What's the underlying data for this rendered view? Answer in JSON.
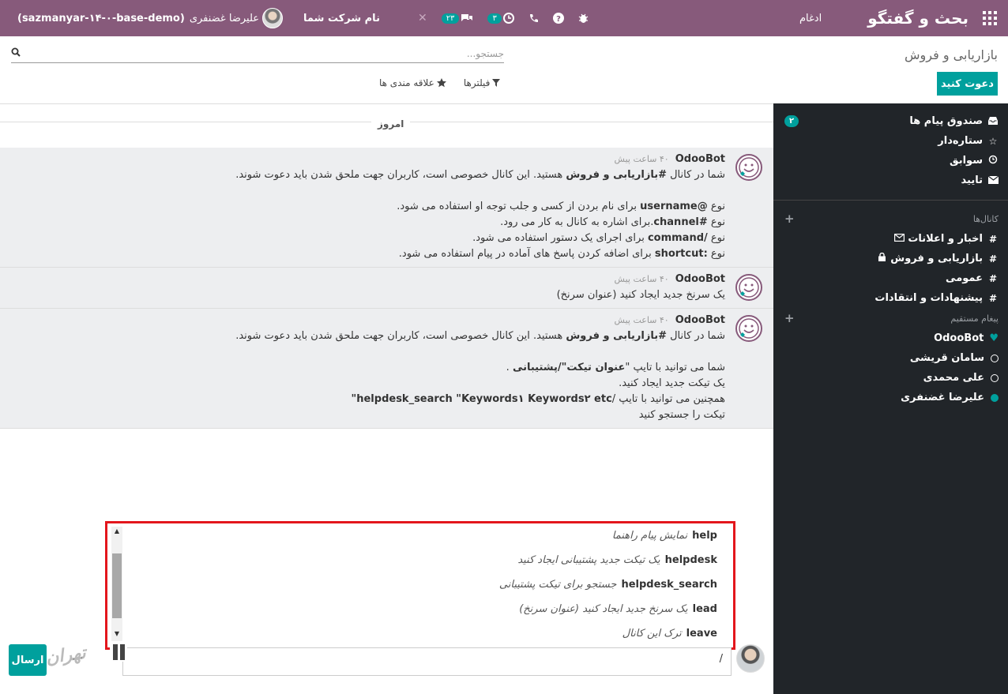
{
  "navbar": {
    "brand": "بحث و گفتگو",
    "merge": "ادغام",
    "company": "نام شرکت شما",
    "user_name": "علیرضا غضنفری",
    "db_name": "(sazmanyar-۱۴-۰-base-demo)",
    "messages_count": "۲۳",
    "activities_count": "۳"
  },
  "control": {
    "title": "بازاریابی و فروش",
    "invite_label": "دعوت کنید",
    "search_placeholder": "جستجو...",
    "filters_label": "فیلترها",
    "favorites_label": "علاقه مندی ها"
  },
  "sidebar": {
    "mailboxes": [
      {
        "label": "صندوق پیام ها",
        "icon": "inbox-icon",
        "badge": "۲"
      },
      {
        "label": "ستاره‌دار",
        "icon": "star-icon"
      },
      {
        "label": "سوابق",
        "icon": "history-icon"
      },
      {
        "label": "تایید",
        "icon": "envelope-icon"
      }
    ],
    "channels_header": "کانال‌ها",
    "channels": [
      {
        "label": "اخبار و اعلانات",
        "icon": "hash-icon"
      },
      {
        "label": "بازاریابی و فروش",
        "icon": "hash-icon"
      },
      {
        "label": "عمومی",
        "icon": "hash-icon"
      },
      {
        "label": "پیشنهادات و انتقادات",
        "icon": "hash-icon"
      }
    ],
    "direct_header": "پیغام مستقیم",
    "direct": [
      {
        "label": "OdooBot",
        "status": "bot"
      },
      {
        "label": "سامان قریشی",
        "status": "offline"
      },
      {
        "label": "علی محمدی",
        "status": "offline"
      },
      {
        "label": "علیرضا غضنفری",
        "status": "online"
      }
    ]
  },
  "thread": {
    "day_label": "امروز",
    "messages": [
      {
        "author": "OdooBot",
        "time": "۴۰ ساعت پیش",
        "line1_pre": "شما در کانال ",
        "line1_bold": "#بازاریابی و فروش",
        "line1_post": " هستید. این کانال خصوصی است، کاربران جهت ملحق شدن باید دعوت شوند.",
        "h1_pre": "نوع ",
        "h1_bold": "@username",
        "h1_post": " برای نام بردن از کسی و جلب توجه او استفاده می شود.",
        "h2_pre": "نوع ",
        "h2_bold": "#channel",
        "h2_post": ".برای اشاره به کانال به کار می رود.",
        "h3_pre": "نوع ",
        "h3_bold": "/command",
        "h3_post": " برای اجرای یک دستور استفاده می شود.",
        "h4_pre": "نوع ",
        "h4_bold": ":shortcut",
        "h4_post": " برای اضافه کردن پاسخ های آماده در پیام استفاده می شود."
      },
      {
        "author": "OdooBot",
        "time": "۴۰ ساعت پیش",
        "body": "یک سرنخ جدید ایجاد کنید (عنوان سرنخ)"
      },
      {
        "author": "OdooBot",
        "time": "۴۰ ساعت پیش",
        "line1_pre": "شما در کانال ",
        "line1_bold": "#بازاریابی و فروش",
        "line1_post": " هستید. این کانال خصوصی است، کاربران جهت ملحق شدن باید دعوت شوند.",
        "t1_pre": "شما می توانید با تایپ \"",
        "t1_bold": "عنوان تیکت\"/پشتیبانی",
        "t1_post": " .",
        "t2": "یک تیکت جدید ایجاد کنید.",
        "t3_pre": "همچنین می توانید با تایپ /",
        "t3_bold": "helpdesk_search \"Keywords۱ Keywords۲ etc\"",
        "t4": "تیکت را جستجو کنید"
      }
    ]
  },
  "commands": [
    {
      "name": "help",
      "desc": "نمایش پیام راهنما"
    },
    {
      "name": "helpdesk",
      "desc": "یک تیکت جدید پشتیبانی ایجاد کنید"
    },
    {
      "name": "helpdesk_search",
      "desc": "جستجو برای تیکت پشتیبانی"
    },
    {
      "name": "lead",
      "desc": "یک سرنخ جدید ایجاد کنید (عنوان سرنخ)"
    },
    {
      "name": "leave",
      "desc": "ترک این کانال"
    }
  ],
  "composer": {
    "value": "/",
    "send_label": "ارسال"
  },
  "watermark": "تهران",
  "colors": {
    "navbar": "#875a7b",
    "accent": "#00a09d",
    "sidebar": "#212529",
    "highlight": "#e3161c"
  }
}
